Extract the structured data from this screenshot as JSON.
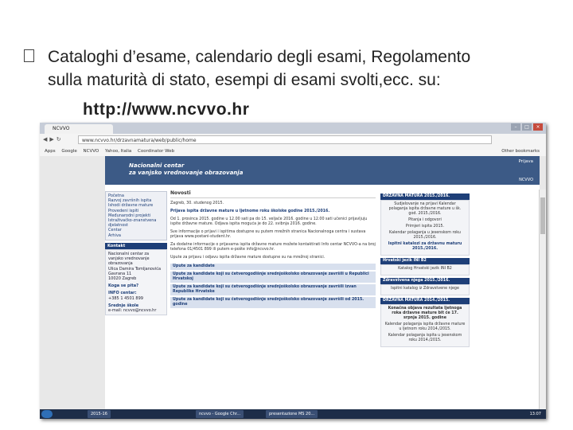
{
  "slide": {
    "line1": "Cataloghi d’esame, calendario degli esami, Regolamento",
    "line2": "sulla maturità di stato, esempi di esami svolti,ecc. su:",
    "url": "http://www.ncvvo.hr"
  },
  "browser": {
    "tab_label": "NCVVO",
    "address": "www.ncvvo.hr/drzavnamatura/web/public/home",
    "bookmarks": [
      "Apps",
      "Google",
      "NCVVO",
      "Yahoo, Italia",
      "Coordinator Web"
    ],
    "other_bookmarks": "Other bookmarks"
  },
  "site": {
    "banner_line1": "Nacionalni centar",
    "banner_line2": "za vanjsko vrednovanje obrazovanja",
    "prijava": "Prijava",
    "ncvvo": "NCVVO",
    "menu": [
      "Početna",
      "Razvoj završnih ispita",
      "Ishodi državne mature",
      "Provedeni ispiti",
      "Međunarodni projekti",
      "Istraživačko-znanstvena djelatnost",
      "Centar",
      "Arhiva"
    ],
    "contact_title": "Kontakt",
    "contact": [
      "Nacionalni centar za vanjsko vrednovanje obrazovanja",
      "Ulica Damira Tomljanovića Gavrana 11",
      "10020 Zagreb"
    ],
    "contact_who": "Koga se pita?",
    "info_title": "INFO centar:",
    "info_phone": "+385 1 4501 899",
    "school_title": "Srednje škole",
    "school_email": "e-mail: ncvvo@ncvvo.hr",
    "news_title": "Novosti",
    "news_date": "Zagreb, 30. studenog 2015.",
    "news_p1": "Prijava ispita državne mature u ljetnome roku školske godine 2015./2016.",
    "news_p2": "Od 1. prosinca 2015. godine u 12.00 sati pa do 15. veljače 2016. godine u 12.00 sati učenici prijavljuju ispite državne mature. Odjava ispita moguća je do 22. svibnja 2016. godine.",
    "news_p3": "Sve informacije o prijavi i ispitima dostupne su putem mrežnih stranica Nacionalnoga centra i sustava prijava www.postani-student.hr.",
    "news_p4": "Za dodatne informacije o prijavama ispita državne mature možete kontaktirati Info centar NCVVO-a na broj telefona 01/4501 899 ili putem e-pošte info@ncvvo.hr.",
    "news_p5": "Upute za prijavu i odjavu ispita državne mature dostupne su na mrežnoj stranici.",
    "notice1": "Upute za kandidate",
    "notice2": "Upute za kandidate koji su četverogodišnje srednjoškolsko obrazovanje završili u Republici Hrvatskoj",
    "notice3": "Upute za kandidate koji su četverogodišnje srednjoškolsko obrazovanje završili izvan Republike Hrvatske",
    "notice4": "Upute za kandidate koji su četverogodišnje srednjoškolsko obrazovanje završili od 2015. godine",
    "right_head1": "DRŽAVNA MATURA 2015./2016.",
    "right_box1": [
      "Sudjelovanje na prijavi Kalendar polaganja ispita državne mature u šk. god. 2015./2016.",
      "Pitanja i odgovori",
      "Primjeri ispita 2015.",
      "Kalendar polaganja u jesenskom roku 2015./2016."
    ],
    "right_link": "Ispitni katalozi za državnu maturu 2015./2016.",
    "right_head2": "Hrvatski jezik INI B2",
    "right_box2": [
      "Katalog Hrvatski jezik INI B2"
    ],
    "right_head3": "Zdravstvena njega 2015./2016.",
    "right_box3": [
      "Ispitni katalog iz Zdravstvene njege"
    ],
    "right_head4": "DRŽAVNA MATURA 2014./2015.",
    "right_box4": [
      "Konačna objava rezultata ljetnoga roka državne mature bit će 17. srpnja 2015. godine",
      "Kalendar polaganja ispita državne mature u ljetnom roku 2014./2015.",
      "Kalendar polaganja ispita u jesenskom roku 2014./2015."
    ]
  },
  "taskbar": {
    "items": [
      "2015-16",
      "ncvvo - Google Chr...",
      "presentazione MS 20..."
    ],
    "clock": "13:07"
  }
}
